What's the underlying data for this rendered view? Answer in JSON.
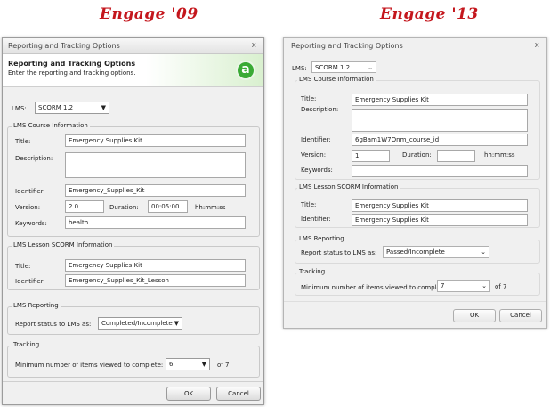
{
  "headings": {
    "left": "Engage '09",
    "right": "Engage '13"
  },
  "dlg09": {
    "window_title": "Reporting and Tracking Options",
    "close_glyph": "x",
    "banner_title": "Reporting and Tracking Options",
    "banner_subtitle": "Enter the reporting and tracking options.",
    "logo_letter": "a",
    "lms_label": "LMS:",
    "lms_value": "SCORM 1.2",
    "course_group": "LMS Course Information",
    "title_label": "Title:",
    "title_value": "Emergency Supplies Kit",
    "description_label": "Description:",
    "description_value": "",
    "identifier_label": "Identifier:",
    "identifier_value": "Emergency_Supplies_Kit",
    "version_label": "Version:",
    "version_value": "2.0",
    "duration_label": "Duration:",
    "duration_value": "00:05:00",
    "duration_unit": "hh:mm:ss",
    "keywords_label": "Keywords:",
    "keywords_value": "health",
    "lesson_group": "LMS Lesson SCORM Information",
    "lesson_title_label": "Title:",
    "lesson_title_value": "Emergency Supplies Kit",
    "lesson_identifier_label": "Identifier:",
    "lesson_identifier_value": "Emergency_Supplies_Kit_Lesson",
    "reporting_group": "LMS Reporting",
    "report_label": "Report status to LMS as:",
    "report_value": "Completed/Incomplete",
    "tracking_group": "Tracking",
    "min_items_label": "Minimum number of items viewed to complete:",
    "min_items_value": "6",
    "of_total": "of 7",
    "ok": "OK",
    "cancel": "Cancel"
  },
  "dlg13": {
    "window_title": "Reporting and Tracking Options",
    "close_glyph": "x",
    "lms_label": "LMS:",
    "lms_value": "SCORM 1.2",
    "course_group": "LMS Course Information",
    "title_label": "Title:",
    "title_value": "Emergency Supplies Kit",
    "description_label": "Description:",
    "description_value": "",
    "identifier_label": "Identifier:",
    "identifier_value": "6gBam1W7Onm_course_id",
    "version_label": "Version:",
    "version_value": "1",
    "duration_label": "Duration:",
    "duration_value": "",
    "duration_unit": "hh:mm:ss",
    "keywords_label": "Keywords:",
    "keywords_value": "",
    "lesson_group": "LMS Lesson SCORM Information",
    "lesson_title_label": "Title:",
    "lesson_title_value": "Emergency Supplies Kit",
    "lesson_identifier_label": "Identifier:",
    "lesson_identifier_value": "Emergency Supplies Kit",
    "reporting_group": "LMS Reporting",
    "report_label": "Report status to LMS as:",
    "report_value": "Passed/Incomplete",
    "tracking_group": "Tracking",
    "min_items_label": "Minimum number of items viewed to complete:",
    "min_items_value": "7",
    "of_total": "of 7",
    "ok": "OK",
    "cancel": "Cancel"
  }
}
